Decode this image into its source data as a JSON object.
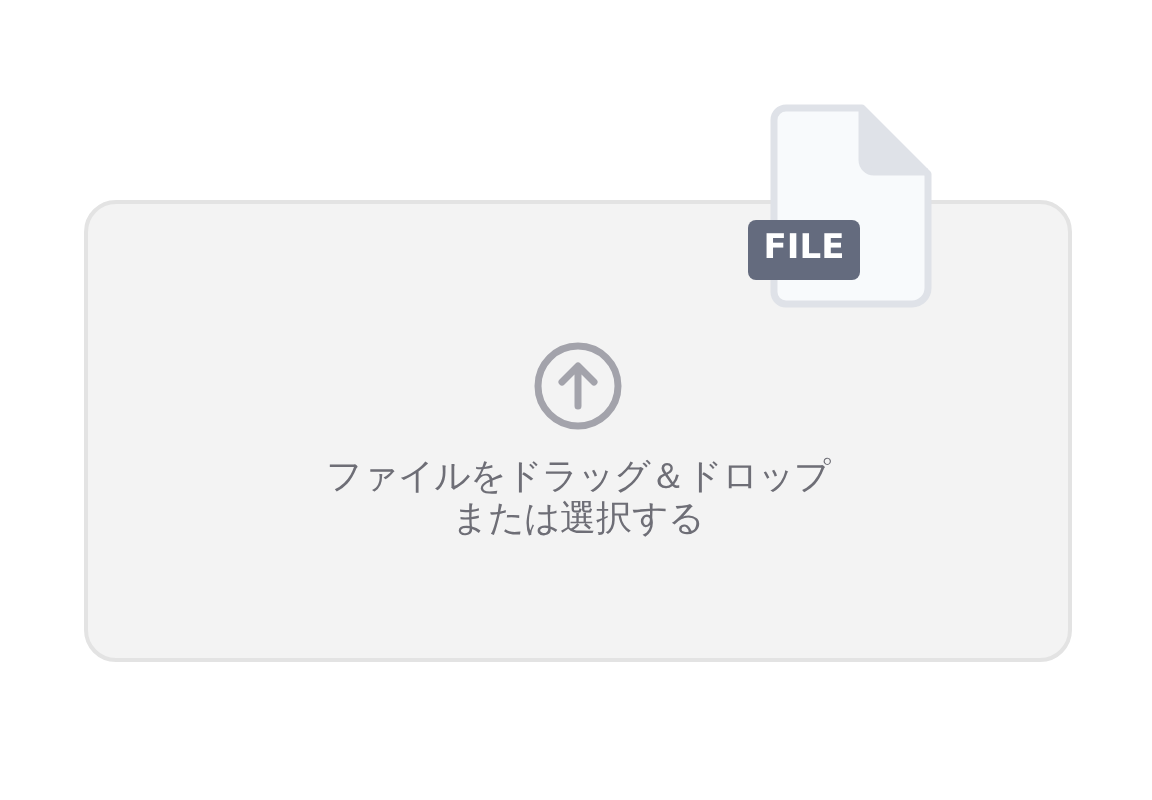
{
  "dropzone": {
    "prompt": [
      "ファイルをドラッグ＆ドロップ",
      "または選択する"
    ]
  },
  "file_icon": {
    "badge": "FILE"
  }
}
